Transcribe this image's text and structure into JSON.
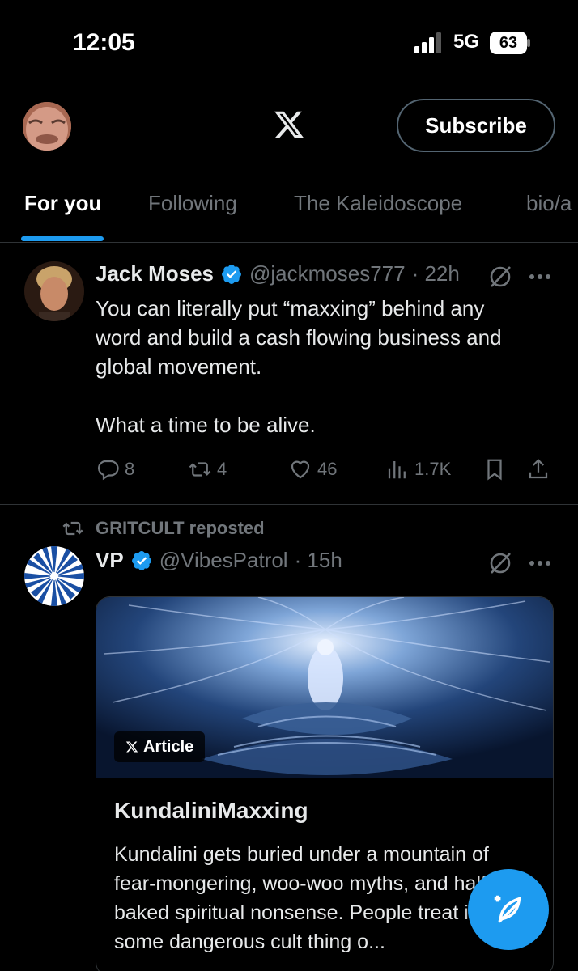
{
  "status_bar": {
    "time": "12:05",
    "network": "5G",
    "battery": "63"
  },
  "header": {
    "logo": "x-logo-icon",
    "subscribe_label": "Subscribe"
  },
  "tabs": [
    {
      "label": "For you",
      "active": true
    },
    {
      "label": "Following",
      "active": false
    },
    {
      "label": "The Kaleidoscope",
      "active": false
    },
    {
      "label": "bio/a",
      "active": false
    }
  ],
  "posts": [
    {
      "display_name": "Jack Moses",
      "handle": "@jackmoses777",
      "time": "· 22h",
      "verified": true,
      "text_lines": [
        "You can literally put “maxxing” behind any",
        "word and build a cash flowing business and",
        "global movement."
      ],
      "text_line2": "What a time to be alive.",
      "replies": "8",
      "reposts": "4",
      "likes": "46",
      "views": "1.7K"
    },
    {
      "repost_label": "GRITCULT reposted",
      "display_name": "VP",
      "handle": "@VibesPatrol",
      "time": "· 15h",
      "verified": true,
      "article": {
        "badge": "Article",
        "title": "KundaliniMaxxing",
        "summary": "Kundalini gets buried under a mountain of fear-mongering, woo-woo myths, and half-baked spiritual nonsense. People treat it like some dangerous cult thing o..."
      }
    }
  ],
  "colors": {
    "accent": "#1d9bf0",
    "muted": "#71767b",
    "divider": "#2f3336"
  }
}
